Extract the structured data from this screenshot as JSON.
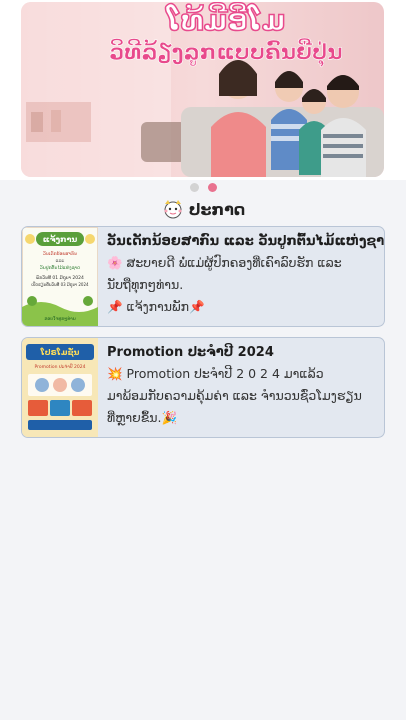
{
  "banner": {
    "headline_line1": "ໂທ້ມີອີໂມ",
    "headline_line2": "ວິທີລ້ຽງລູກແບບຄົນຍີ່ປຸ່ນ",
    "colors": {
      "headline": "#e84a8c",
      "bg": "#f6d6d6"
    }
  },
  "carousel": {
    "count": 2,
    "active_index": 1
  },
  "section": {
    "title": "ປະກາດ",
    "icon": "mascot-icon"
  },
  "announcements": [
    {
      "title": "ວັນເດັກນ້ອຍສາກົນ ແລະ ວັນປູກຕົ້ນໄມ້ແຫ່ງຊາດ",
      "lines": [
        "🌸 ສະບາຍດີ ພໍ່ແມ່ຜູ້ປົກຄອງທີ່ເຄົາລົບຮັກ ແລະ",
        "ນັບຖືທຸກໆທ່ານ.",
        "📌 ແຈ້ງການພັກ📌"
      ],
      "thumb": {
        "heading": "ແຈ້ງການ",
        "line1": "ວັນເດັກນ້ອຍສາກົນ",
        "line2": "ແລະ",
        "line3": "ວັນປູກຕົ້ນໄມ້ແຫ່ງຊາດ",
        "line4": "ພັກວັນທີ 01 ມິຖຸນາ 2024",
        "line5": "ເປີດຮຽນຄືນວັນທີ 03 ມິຖຸນາ 2024",
        "footer": "ຂອບໃຈທຸກໆທ່ານ"
      }
    },
    {
      "title": "Promotion ປະຈຳປີ 2024",
      "lines": [
        "💥 Promotion ປະຈຳປີ  2 0 2 4 ມາແລ້ວ",
        "ມາພ້ອມກັບຄວາມຄຸ້ມຄ່າ ແລະ ຈຳນວນຊົ່ວໂມງຮຽນ",
        "ທີ່ຫຼາຍຂຶ້ນ.🎉"
      ],
      "thumb": {
        "heading": "ໂປຣໂມຊັ່ນ",
        "subheading": "Promotion ປະຈຳປີ 2024"
      }
    }
  ]
}
